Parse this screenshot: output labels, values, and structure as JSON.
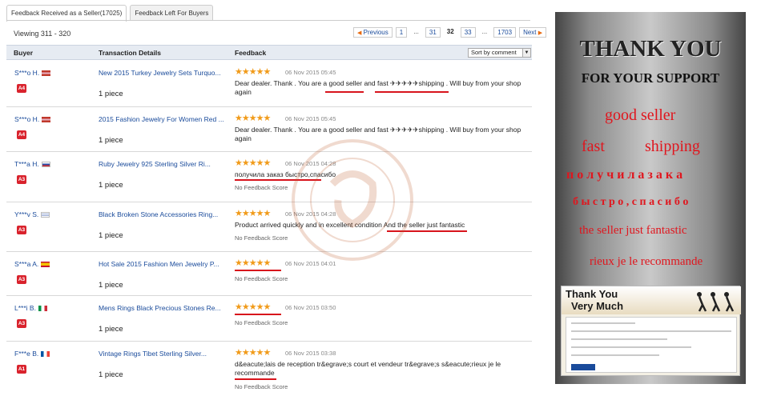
{
  "tabs": [
    {
      "label": "Feedback Received as a Seller(17025)",
      "active": true
    },
    {
      "label": "Feedback Left For Buyers",
      "active": false
    }
  ],
  "viewing": "Viewing 311 - 320",
  "pagination": {
    "previous": "Previous",
    "pages": [
      "1",
      "...",
      "31",
      "32",
      "33",
      "...",
      "1703"
    ],
    "current": "32",
    "next": "Next"
  },
  "table": {
    "columns": {
      "buyer": "Buyer",
      "transaction": "Transaction Details",
      "feedback": "Feedback"
    },
    "sort": "Sort by comment",
    "rows": [
      {
        "buyer": "S***o H.",
        "badge": "A4",
        "product": "New 2015 Turkey Jewelry Sets Turquo...",
        "qty": "1 piece",
        "stars": "★★★★★",
        "date": "06 Nov 2015 05:45",
        "feedback": "Dear dealer. Thank . You are a good seller and fast ✈✈✈✈✈shipping . Will buy from your shop again",
        "nfs": ""
      },
      {
        "buyer": "S***o H.",
        "badge": "A4",
        "product": "2015 Fashion Jewelry For Women Red ...",
        "qty": "1 piece",
        "stars": "★★★★★",
        "date": "06 Nov 2015 05:45",
        "feedback": "Dear dealer. Thank . You are a good seller and fast ✈✈✈✈✈shipping . Will buy from your shop again",
        "nfs": ""
      },
      {
        "buyer": "T***a H.",
        "badge": "A3",
        "product": "Ruby Jewelry 925 Sterling Silver Ri...",
        "qty": "1 piece",
        "stars": "★★★★★",
        "date": "06 Nov 2015 04:28",
        "feedback": "получила заказ быстро,спасибо",
        "nfs": "No Feedback Score"
      },
      {
        "buyer": "Y***v S.",
        "badge": "A3",
        "product": "Black Broken Stone Accessories Ring...",
        "qty": "1 piece",
        "stars": "★★★★★",
        "date": "06 Nov 2015 04:28",
        "feedback": "Product arrived quickly and in excellent condition And the seller just fantastic",
        "nfs": "No Feedback Score"
      },
      {
        "buyer": "S***a A.",
        "badge": "A3",
        "product": "Hot Sale 2015 Fashion Men Jewelry P...",
        "qty": "1 piece",
        "stars": "★★★★★",
        "date": "06 Nov 2015 04:01",
        "feedback": "",
        "nfs": "No Feedback Score"
      },
      {
        "buyer": "L***i B.",
        "badge": "A3",
        "product": "Mens Rings Black Precious Stones Re...",
        "qty": "1 piece",
        "stars": "★★★★★",
        "date": "06 Nov 2015 03:50",
        "feedback": "",
        "nfs": "No Feedback Score"
      },
      {
        "buyer": "F***e B.",
        "badge": "A1",
        "product": "Vintage Rings Tibet Sterling Silver...",
        "qty": "1 piece",
        "stars": "★★★★★",
        "date": "06 Nov 2015 03:38",
        "feedback": "d&eacute;lais de reception tr&egrave;s court et vendeur tr&egrave;s s&eacute;rieux je le recommande",
        "nfs": "No Feedback Score"
      }
    ]
  },
  "banner": {
    "thank_you": "THANK YOU",
    "support": "FOR YOUR SUPPORT",
    "good_seller": "good seller",
    "fast": "fast",
    "shipping": "shipping",
    "ru1": "п о л у ч и л а  з а к а",
    "ru2": "б ы с т р о , с п а с и б о",
    "fantastic": "the seller just fantastic",
    "recommande": "rieux je le recommande",
    "card_line1": "Thank You",
    "card_line2": "Very Much"
  },
  "colors": {
    "accent_red": "#d8141c",
    "link_blue": "#1a4b9b",
    "star_orange": "#f19b1a"
  }
}
